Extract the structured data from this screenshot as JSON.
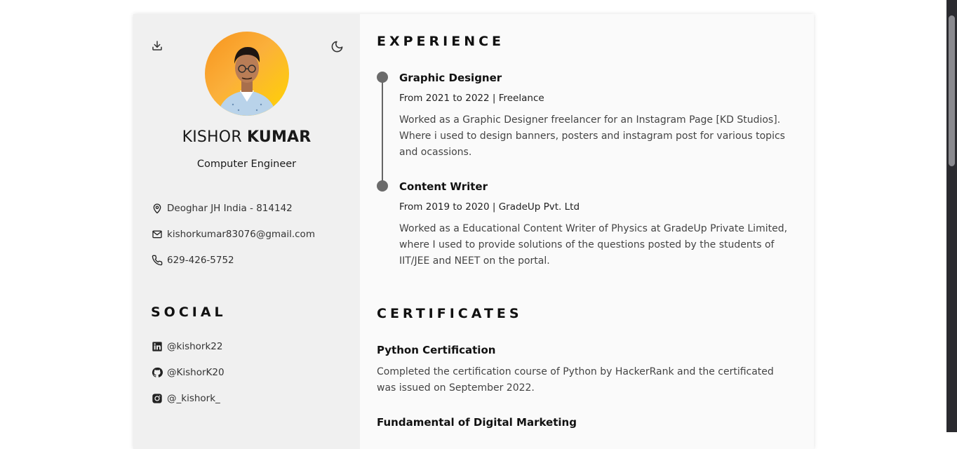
{
  "profile": {
    "first_name": "KISHOR",
    "last_name": "KUMAR",
    "profession": "Computer Engineer"
  },
  "info": [
    {
      "icon": "map-pin-icon",
      "text": "Deoghar JH India - 814142"
    },
    {
      "icon": "mail-icon",
      "text": "kishorkumar83076@gmail.com"
    },
    {
      "icon": "phone-icon",
      "text": "629-426-5752"
    }
  ],
  "social": {
    "title": "SOCIAL",
    "items": [
      {
        "icon": "linkedin-icon",
        "text": "@kishork22"
      },
      {
        "icon": "github-icon",
        "text": "@KishorK20"
      },
      {
        "icon": "instagram-icon",
        "text": "@_kishork_"
      }
    ]
  },
  "experience": {
    "title": "EXPERIENCE",
    "items": [
      {
        "title": "Graphic Designer",
        "subtitle": "From 2021 to 2022 | Freelance",
        "description": "Worked as a Graphic Designer freelancer for an Instagram Page [KD Studios]. Where i used to design banners, posters and instagram post for various topics and ocassions."
      },
      {
        "title": "Content Writer",
        "subtitle": "From 2019 to 2020 | GradeUp Pvt. Ltd",
        "description": "Worked as a Educational Content Writer of Physics at GradeUp Private Limited, where I used to provide solutions of the questions posted by the students of IIT/JEE and NEET on the portal."
      }
    ]
  },
  "certificates": {
    "title": "CERTIFICATES",
    "items": [
      {
        "title": "Python Certification",
        "description": "Completed the certification course of Python by HackerRank and the certificated was issued on September 2022."
      },
      {
        "title": "Fundamental of Digital Marketing",
        "description": ""
      }
    ]
  },
  "toolbar": {
    "download_icon": "download-icon",
    "theme_icon": "moon-icon"
  },
  "colors": {
    "sidebar_bg": "#f0f0f0",
    "main_bg": "#fafafa",
    "timeline": "#6b6b6b",
    "avatar_gradient_start": "#f7941d",
    "avatar_gradient_end": "#ffd400"
  }
}
